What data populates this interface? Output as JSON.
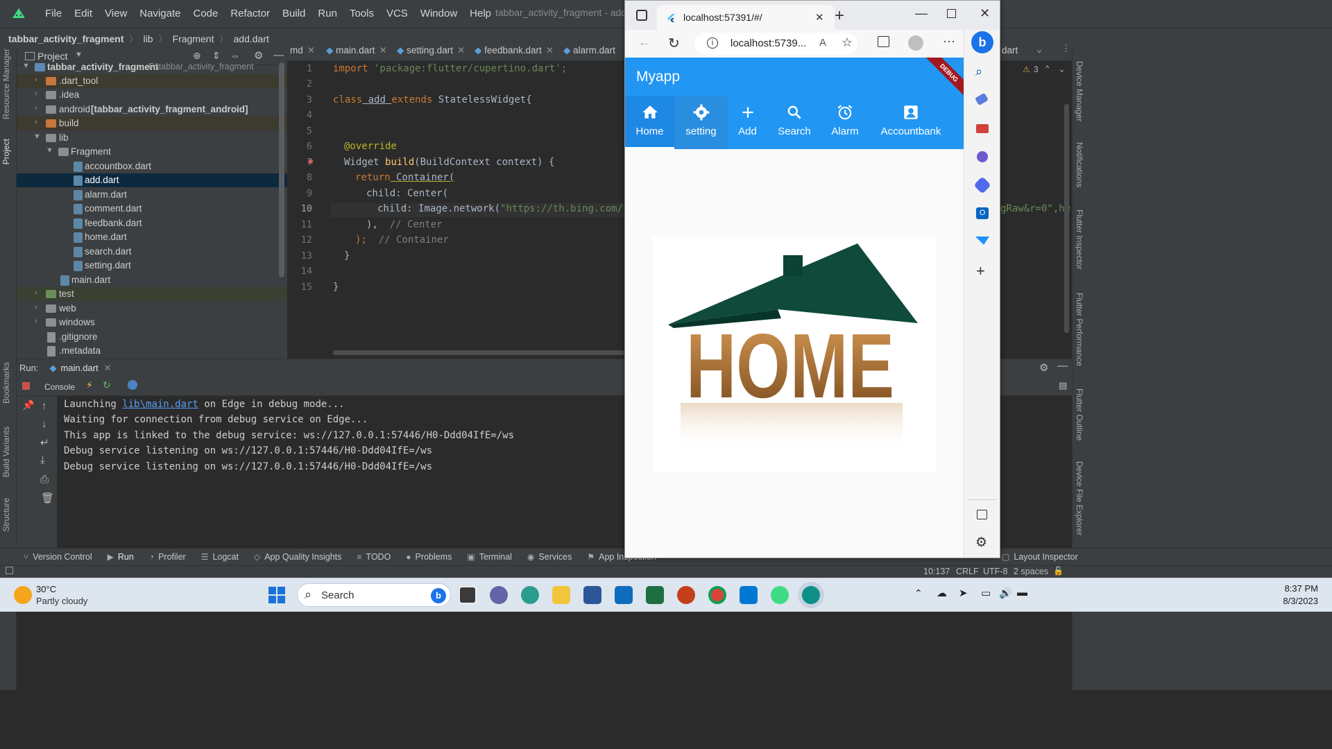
{
  "ide": {
    "menu": [
      "File",
      "Edit",
      "View",
      "Navigate",
      "Code",
      "Refactor",
      "Build",
      "Run",
      "Tools",
      "VCS",
      "Window",
      "Help"
    ],
    "window_title": "tabbar_activity_fragment - add.dart [tabbar_activity_fragme",
    "breadcrumb": [
      "tabbar_activity_fragment",
      "lib",
      "Fragment",
      "add.dart"
    ],
    "project_panel": {
      "title": "Project",
      "root": "tabbar_activity_fragment",
      "root_path": "F:\\tabbar_activity_fragment",
      "items": [
        {
          "label": ".dart_tool"
        },
        {
          "label": ".idea"
        },
        {
          "label": "android",
          "suffix": "[tabbar_activity_fragment_android]"
        },
        {
          "label": "build"
        },
        {
          "label": "lib"
        },
        {
          "label": "Fragment"
        },
        {
          "label": "accountbox.dart"
        },
        {
          "label": "add.dart"
        },
        {
          "label": "alarm.dart"
        },
        {
          "label": "comment.dart"
        },
        {
          "label": "feedbank.dart"
        },
        {
          "label": "home.dart"
        },
        {
          "label": "search.dart"
        },
        {
          "label": "setting.dart"
        },
        {
          "label": "main.dart"
        },
        {
          "label": "test"
        },
        {
          "label": "web"
        },
        {
          "label": "windows"
        },
        {
          "label": ".gitignore"
        },
        {
          "label": ".metadata"
        }
      ]
    },
    "editor_tabs": [
      "md",
      "main.dart",
      "setting.dart",
      "feedbank.dart",
      "alarm.dart"
    ],
    "editor_tab_right": "dart",
    "inspection_count": "3",
    "code": {
      "line_numbers": [
        "1",
        "2",
        "3",
        "4",
        "5",
        "6",
        "7",
        "8",
        "9",
        "10",
        "11",
        "12",
        "13",
        "14",
        "15"
      ],
      "l1_kw": "import",
      "l1_str": " 'package:flutter/cupertino.dart';",
      "l3_kw1": "class",
      "l3_name": " add ",
      "l3_kw2": "extends",
      "l3_rest": " StatelessWidget{",
      "l6": "@override",
      "l7_a": "Widget ",
      "l7_fn": "build",
      "l7_b": "(BuildContext context) {",
      "l8_kw": "return",
      "l8_b": " Container(",
      "l9": "child: Center(",
      "l10_a": "child: Image.network(",
      "l10_str": "\"https://th.bing.com/th",
      "l10_right": "gRaw&r=0\",he",
      "l11_a": "),",
      "l11_cm": "  // Center",
      "l12_a": ");",
      "l12_cm": "  // Container",
      "l13": "}",
      "l15": "}"
    },
    "run": {
      "label": "Run:",
      "config": "main.dart",
      "console_tab": "Console",
      "lines": [
        {
          "pre": "Launching ",
          "link": "lib\\main.dart",
          "post": " on Edge in debug mode..."
        },
        {
          "pre": "Waiting for connection from debug service on Edge...",
          "link": "",
          "post": ""
        },
        {
          "pre": "This app is linked to the debug service: ws://127.0.0.1:57446/H0-Ddd04IfE=/ws",
          "link": "",
          "post": ""
        },
        {
          "pre": "Debug service listening on ws://127.0.0.1:57446/H0-Ddd04IfE=/ws",
          "link": "",
          "post": ""
        },
        {
          "pre": "Debug service listening on ws://127.0.0.1:57446/H0-Ddd04IfE=/ws",
          "link": "",
          "post": ""
        }
      ]
    },
    "bottom_tabs": [
      "Version Control",
      "Run",
      "Profiler",
      "Logcat",
      "App Quality Insights",
      "TODO",
      "Problems",
      "Terminal",
      "Services",
      "App Inspection"
    ],
    "bottom_right_tab": "Layout Inspector",
    "left_vtabs": [
      "Resource Manager",
      "Project",
      "Bookmarks",
      "Build Variants",
      "Structure"
    ],
    "right_vtabs": [
      "Device Manager",
      "Notifications",
      "Flutter Inspector",
      "Flutter Performance",
      "Flutter Outline",
      "Device File Explorer"
    ],
    "status": {
      "position": "10:137",
      "line_sep": "CRLF",
      "encoding": "UTF-8",
      "indent": "2 spaces"
    }
  },
  "browser": {
    "tab_title": "localhost:57391/#/",
    "address": "localhost:5739...",
    "app": {
      "title": "Myapp",
      "debug_banner": "DEBUG",
      "tabs": [
        {
          "label": "Home",
          "icon": "home-icon"
        },
        {
          "label": "setting",
          "icon": "gear-icon"
        },
        {
          "label": "Add",
          "icon": "plus-icon"
        },
        {
          "label": "Search",
          "icon": "search-icon"
        },
        {
          "label": "Alarm",
          "icon": "alarm-icon"
        },
        {
          "label": "Accountbank",
          "icon": "account-box-icon"
        }
      ],
      "image_text": "HOME",
      "accent": "#2196f3"
    }
  },
  "taskbar": {
    "temperature": "30°C",
    "weather": "Partly cloudy",
    "search_placeholder": "Search",
    "time": "8:37 PM",
    "date": "8/3/2023"
  }
}
